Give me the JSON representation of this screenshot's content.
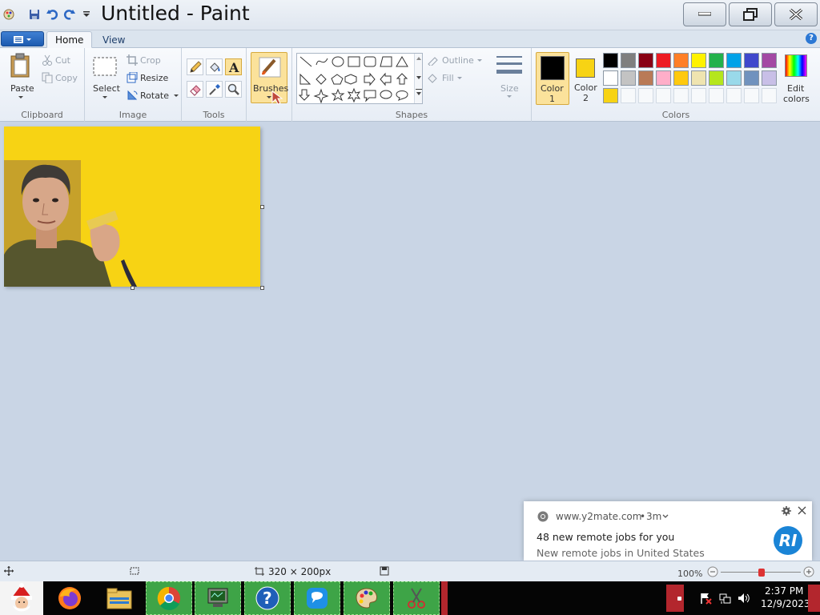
{
  "window": {
    "title": "Untitled - Paint",
    "controls": {
      "minimize": "minimize",
      "restore": "restore",
      "close": "close"
    }
  },
  "ribbon_tabs": [
    {
      "label": "Home",
      "active": true
    },
    {
      "label": "View",
      "active": false
    }
  ],
  "clipboard": {
    "group_label": "Clipboard",
    "paste": "Paste",
    "cut": "Cut",
    "copy": "Copy"
  },
  "image": {
    "group_label": "Image",
    "select": "Select",
    "crop": "Crop",
    "resize": "Resize",
    "rotate": "Rotate"
  },
  "tools": {
    "group_label": "Tools",
    "items": [
      "pencil-icon",
      "fill-icon",
      "text-icon",
      "eraser-icon",
      "color-picker-icon",
      "magnifier-icon"
    ],
    "selected": "text-icon"
  },
  "brushes": {
    "label": "Brushes"
  },
  "shapes": {
    "group_label": "Shapes",
    "outline": "Outline",
    "fill": "Fill"
  },
  "size": {
    "label": "Size"
  },
  "colors": {
    "group_label": "Colors",
    "color1_label": "Color",
    "color1_num": "1",
    "color1_value": "#000000",
    "color2_label": "Color",
    "color2_num": "2",
    "color2_value": "#f7d314",
    "edit_colors_line1": "Edit",
    "edit_colors_line2": "colors",
    "palette_row1": [
      "#000000",
      "#7f7f7f",
      "#880015",
      "#ed1c24",
      "#ff7f27",
      "#fff200",
      "#22b14c",
      "#00a2e8",
      "#3f48cc",
      "#a349a4"
    ],
    "palette_row2": [
      "#ffffff",
      "#c3c3c3",
      "#b97a57",
      "#ffaec9",
      "#ffc90e",
      "#efe4b0",
      "#b5e61d",
      "#99d9ea",
      "#7092be",
      "#c8bfe7"
    ],
    "palette_row3_first": "#f7d314"
  },
  "canvas": {
    "background": "#f7d314"
  },
  "statusbar": {
    "dimensions": "320 × 200px",
    "zoom": "100%"
  },
  "notification": {
    "source": "www.y2mate.com",
    "age": "3m",
    "headline": "48 new remote jobs for you",
    "body": "New remote jobs in United States",
    "avatar_text": "RI"
  },
  "taskbar": {
    "time": "2:37 PM",
    "date": "12/9/2023"
  }
}
